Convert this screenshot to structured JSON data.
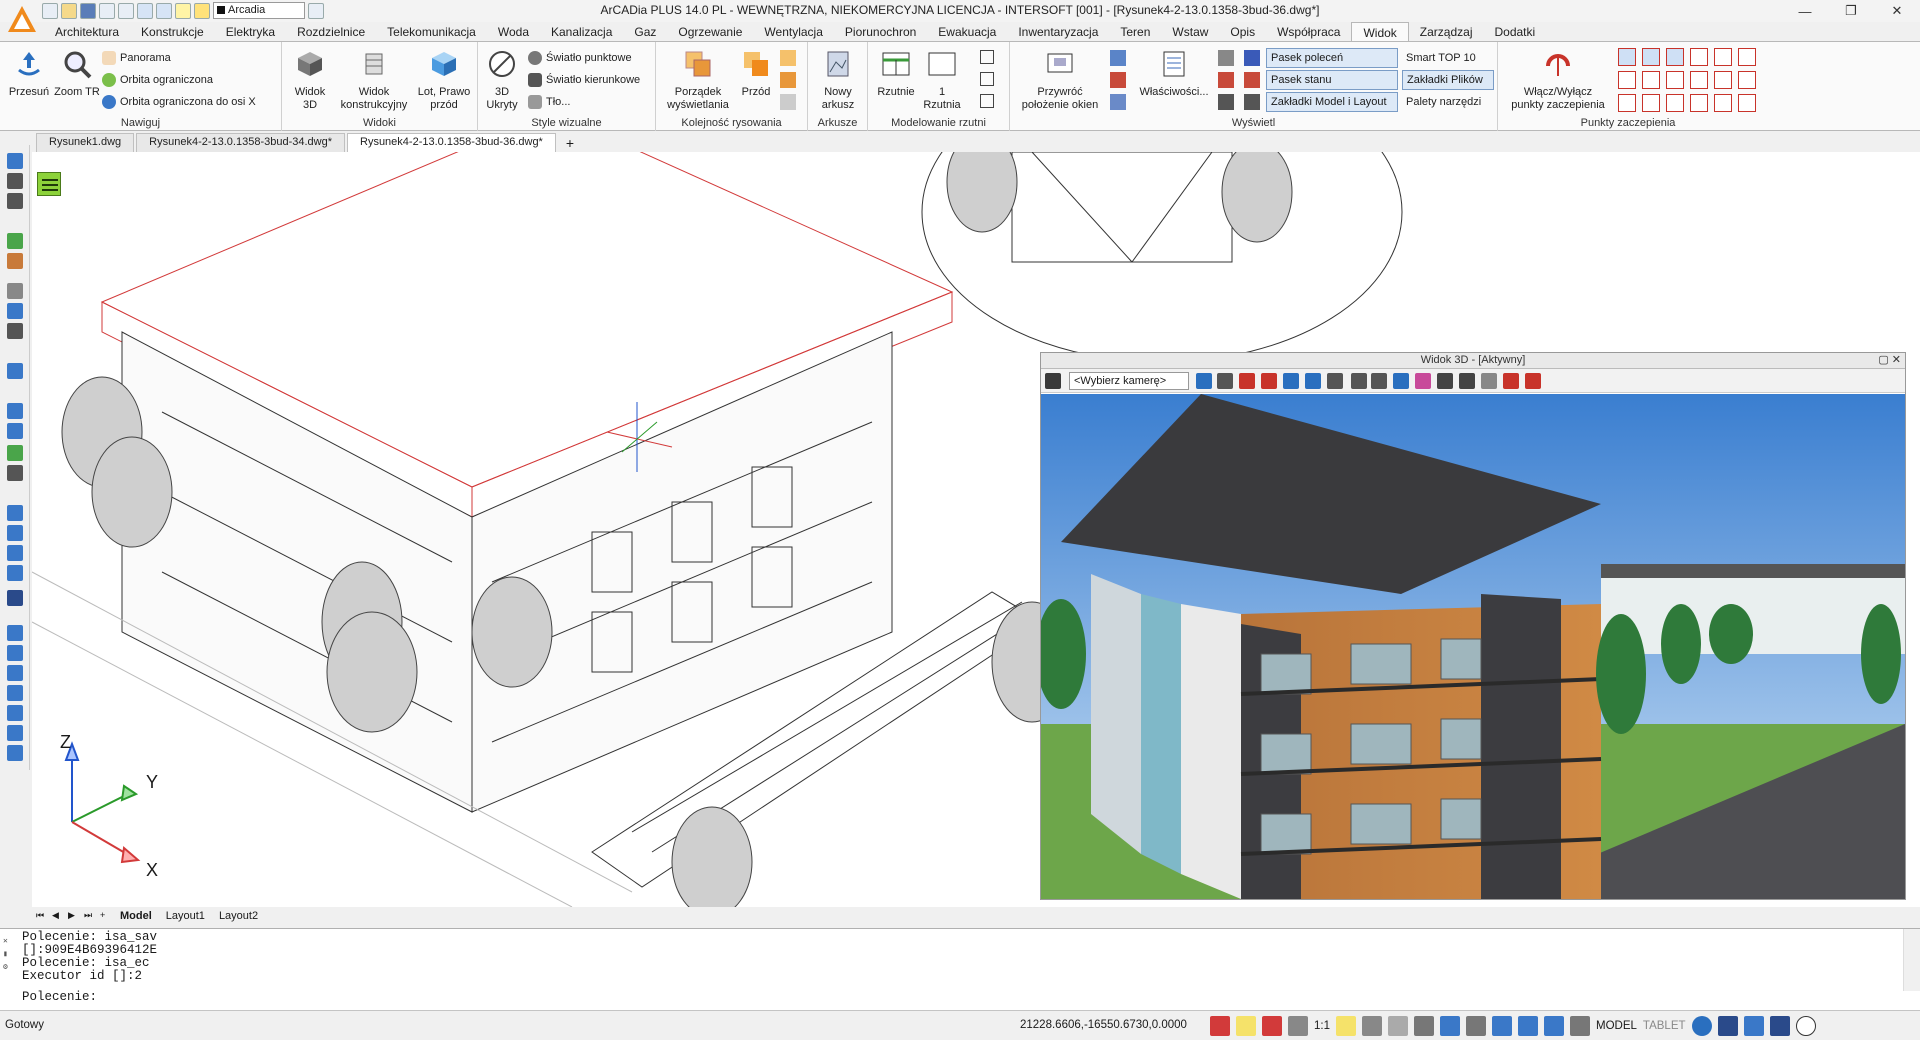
{
  "window": {
    "title": "ArCADia PLUS 14.0 PL - WEWNĘTRZNA, NIEKOMERCYJNA LICENCJA - INTERSOFT [001] - [Rysunek4-2-13.0.1358-3bud-36.dwg*]",
    "layer_combo": "Arcadia"
  },
  "ribbon_tabs": [
    "Architektura",
    "Konstrukcje",
    "Elektryka",
    "Rozdzielnice",
    "Telekomunikacja",
    "Woda",
    "Kanalizacja",
    "Gaz",
    "Ogrzewanie",
    "Wentylacja",
    "Piorunochron",
    "Ewakuacja",
    "Inwentaryzacja",
    "Teren",
    "Wstaw",
    "Opis",
    "Współpraca",
    "Widok",
    "Zarządzaj",
    "Dodatki"
  ],
  "active_tab_index": 17,
  "ribbon": {
    "nawiguj": {
      "title": "Nawiguj",
      "przesun": "Przesuń",
      "zoom": "Zoom TR",
      "panorama": "Panorama",
      "orbita": "Orbita ograniczona",
      "orbita_x": "Orbita ograniczona do osi X"
    },
    "widoki": {
      "title": "Widoki",
      "widok3d_1": "Widok",
      "widok3d_2": "3D",
      "konstr_1": "Widok",
      "konstr_2": "konstrukcyjny",
      "lot_1": "Lot, Prawo",
      "lot_2": "przód"
    },
    "style": {
      "title": "Style wizualne",
      "ukryty_1": "3D",
      "ukryty_2": "Ukryty",
      "punktowe": "Światło punktowe",
      "kierunkowe": "Światło kierunkowe",
      "tlo": "Tło..."
    },
    "kolejnosc": {
      "title": "Kolejność rysowania",
      "porzadek_1": "Porządek",
      "porzadek_2": "wyświetlania",
      "przod": "Przód"
    },
    "arkusze": {
      "title": "Arkusze",
      "nowy_1": "Nowy",
      "nowy_2": "arkusz"
    },
    "rzuty": {
      "title": "Modelowanie rzutni",
      "rzutnie": "Rzutnie",
      "jedna_1": "1",
      "jedna_2": "Rzutnia"
    },
    "wyswietl": {
      "title": "Wyświetl",
      "przywroc_1": "Przywróć",
      "przywroc_2": "położenie okien",
      "wlasciwosci": "Właściwości...",
      "pasek_polecen": "Pasek poleceń",
      "pasek_stanu": "Pasek stanu",
      "zakladki_ml": "Zakładki Model i Layout",
      "smart_top": "Smart TOP 10",
      "zakladki_plikow": "Zakładki Plików",
      "palety": "Palety narzędzi"
    },
    "punkty": {
      "title": "Punkty zaczepienia",
      "wlacz_1": "Włącz/Wyłącz",
      "wlacz_2": "punkty zaczepienia"
    }
  },
  "doc_tabs": [
    "Rysunek1.dwg",
    "Rysunek4-2-13.0.1358-3bud-34.dwg*",
    "Rysunek4-2-13.0.1358-3bud-36.dwg*"
  ],
  "viewport3d": {
    "title": "Widok 3D - [Aktywny]",
    "camera": "<Wybierz kamerę>"
  },
  "axes": {
    "z": "Z",
    "y": "Y",
    "x": "X"
  },
  "layout_tabs": [
    "Model",
    "Layout1",
    "Layout2"
  ],
  "command_line": {
    "history": [
      "Polecenie: isa_sav",
      " []:909E4B69396412E",
      "Polecenie: isa_ec",
      "Executor id []:2"
    ],
    "prompt": "Polecenie:"
  },
  "status_bar": {
    "state": "Gotowy",
    "coords": "21228.6606,-16550.6730,0.0000",
    "scale": "1:1",
    "model": "MODEL",
    "tablet": "TABLET"
  },
  "colors": {
    "accent_orange": "#f08a1c",
    "tab_active_border": "#b8b8b8",
    "panel_highlight": "#dde9f7",
    "command_menu_green": "#8cd23a"
  }
}
